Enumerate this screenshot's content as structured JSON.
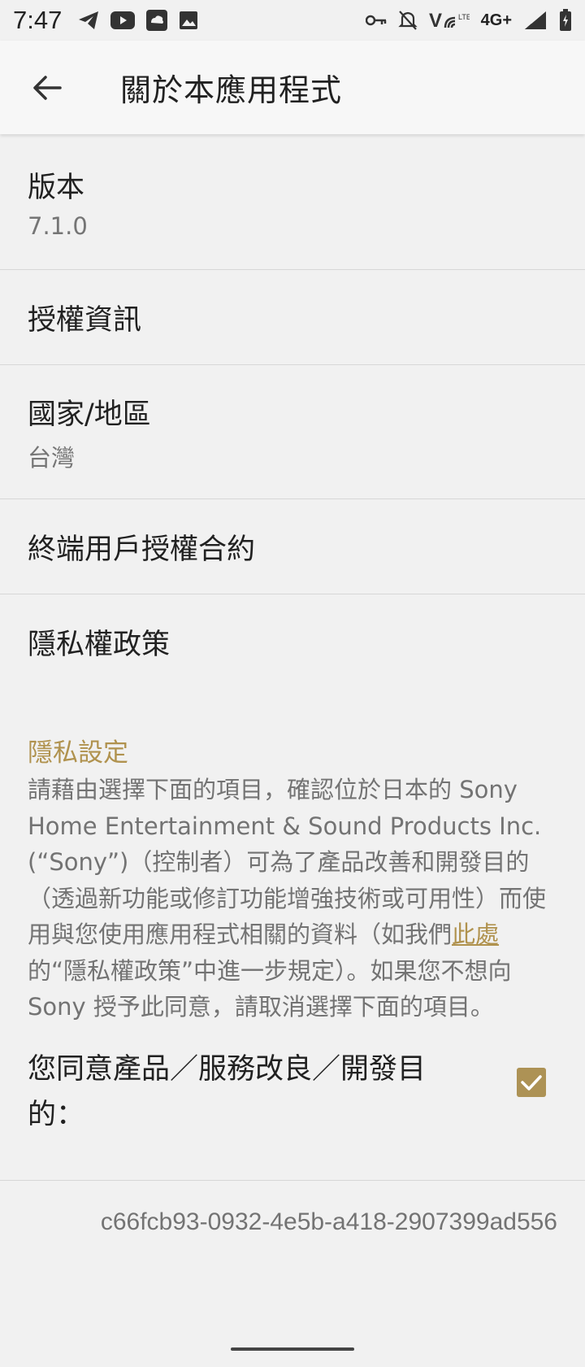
{
  "status_bar": {
    "time": "7:47",
    "network": "4G+",
    "icons": [
      "telegram-icon",
      "youtube-icon",
      "cloud-app-icon",
      "gallery-icon",
      "key-icon",
      "bell-off-icon",
      "volte-icon",
      "signal-icon",
      "battery-icon"
    ]
  },
  "appbar": {
    "title": "關於本應用程式",
    "back_icon": "arrow-left-icon"
  },
  "rows": [
    {
      "title": "版本",
      "subtitle": "7.1.0"
    },
    {
      "title": "授權資訊"
    },
    {
      "title": "國家/地區",
      "subtitle": "台灣"
    },
    {
      "title": "終端用戶授權合約"
    },
    {
      "title": "隱私權政策"
    }
  ],
  "privacy": {
    "section_title": "隱私設定",
    "text_before": "請藉由選擇下面的項目，確認位於日本的 Sony Home Entertainment & Sound Products Inc. (“Sony”)（控制者）可為了產品改善和開發目的（透過新功能或修訂功能增強技術或可用性）而使用與您使用應用程式相關的資料（如我們",
    "link": "此處",
    "text_after": "的“隱私權政策”中進一步規定）。如果您不想向 Sony 授予此同意，請取消選擇下面的項目。",
    "consent_label": "您同意產品／服務改良／開發目的：",
    "consent_checked": true
  },
  "device_id": "c66fcb93-0932-4e5b-a418-2907399ad556",
  "colors": {
    "accent": "#b0924e",
    "background": "#f1f1f1",
    "divider": "#d7d7d7"
  }
}
